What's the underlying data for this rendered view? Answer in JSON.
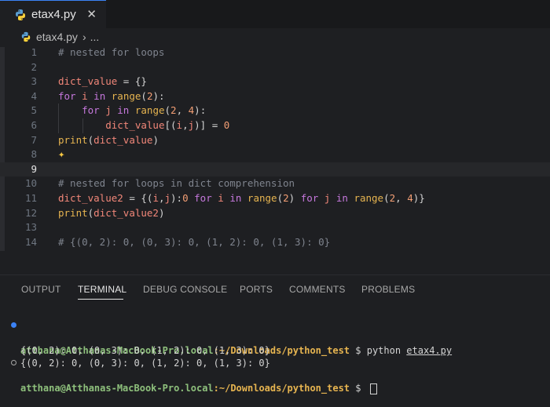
{
  "tab": {
    "label": "etax4.py",
    "close": "✕"
  },
  "breadcrumb": {
    "file": "etax4.py",
    "separator": "›",
    "more": "..."
  },
  "editor": {
    "active_line": 9,
    "lines": [
      {
        "n": "1",
        "tokens": [
          [
            "cm",
            "# nested for loops"
          ]
        ]
      },
      {
        "n": "2",
        "tokens": []
      },
      {
        "n": "3",
        "tokens": [
          [
            "var",
            "dict_value"
          ],
          [
            "op",
            " = "
          ],
          [
            "pn",
            "{}"
          ]
        ]
      },
      {
        "n": "4",
        "tokens": [
          [
            "kw",
            "for"
          ],
          [
            "op",
            " "
          ],
          [
            "var",
            "i"
          ],
          [
            "op",
            " "
          ],
          [
            "kw",
            "in"
          ],
          [
            "op",
            " "
          ],
          [
            "fn",
            "range"
          ],
          [
            "pn",
            "("
          ],
          [
            "num",
            "2"
          ],
          [
            "pn",
            "):"
          ]
        ]
      },
      {
        "n": "5",
        "tokens": [
          [
            "op",
            "    "
          ],
          [
            "kw",
            "for"
          ],
          [
            "op",
            " "
          ],
          [
            "var",
            "j"
          ],
          [
            "op",
            " "
          ],
          [
            "kw",
            "in"
          ],
          [
            "op",
            " "
          ],
          [
            "fn",
            "range"
          ],
          [
            "pn",
            "("
          ],
          [
            "num",
            "2"
          ],
          [
            "pn",
            ", "
          ],
          [
            "num",
            "4"
          ],
          [
            "pn",
            "):"
          ]
        ]
      },
      {
        "n": "6",
        "tokens": [
          [
            "op",
            "        "
          ],
          [
            "var",
            "dict_value"
          ],
          [
            "pn",
            "[("
          ],
          [
            "var",
            "i"
          ],
          [
            "pn",
            ","
          ],
          [
            "var",
            "j"
          ],
          [
            "pn",
            ")]"
          ],
          [
            "op",
            " = "
          ],
          [
            "num",
            "0"
          ]
        ]
      },
      {
        "n": "7",
        "tokens": [
          [
            "fn",
            "print"
          ],
          [
            "pn",
            "("
          ],
          [
            "var",
            "dict_value"
          ],
          [
            "pn",
            ")"
          ]
        ]
      },
      {
        "n": "8",
        "tokens": []
      },
      {
        "n": "9",
        "tokens": []
      },
      {
        "n": "10",
        "tokens": [
          [
            "cm",
            "# nested for loops in dict comprehension"
          ]
        ]
      },
      {
        "n": "11",
        "tokens": [
          [
            "var",
            "dict_value2"
          ],
          [
            "op",
            " = "
          ],
          [
            "pn",
            "{("
          ],
          [
            "var",
            "i"
          ],
          [
            "pn",
            ","
          ],
          [
            "var",
            "j"
          ],
          [
            "pn",
            "):"
          ],
          [
            "num",
            "0"
          ],
          [
            "op",
            " "
          ],
          [
            "kw",
            "for"
          ],
          [
            "op",
            " "
          ],
          [
            "var",
            "i"
          ],
          [
            "op",
            " "
          ],
          [
            "kw",
            "in"
          ],
          [
            "op",
            " "
          ],
          [
            "fn",
            "range"
          ],
          [
            "pn",
            "("
          ],
          [
            "num",
            "2"
          ],
          [
            "pn",
            ")"
          ],
          [
            "op",
            " "
          ],
          [
            "kw",
            "for"
          ],
          [
            "op",
            " "
          ],
          [
            "var",
            "j"
          ],
          [
            "op",
            " "
          ],
          [
            "kw",
            "in"
          ],
          [
            "op",
            " "
          ],
          [
            "fn",
            "range"
          ],
          [
            "pn",
            "("
          ],
          [
            "num",
            "2"
          ],
          [
            "pn",
            ", "
          ],
          [
            "num",
            "4"
          ],
          [
            "pn",
            ")}"
          ]
        ]
      },
      {
        "n": "12",
        "tokens": [
          [
            "fn",
            "print"
          ],
          [
            "pn",
            "("
          ],
          [
            "var",
            "dict_value2"
          ],
          [
            "pn",
            ")"
          ]
        ]
      },
      {
        "n": "13",
        "tokens": []
      },
      {
        "n": "14",
        "tokens": [
          [
            "cm",
            "# {(0, 2): 0, (0, 3): 0, (1, 2): 0, (1, 3): 0}"
          ]
        ]
      }
    ]
  },
  "panel": {
    "tabs": [
      "OUTPUT",
      "TERMINAL",
      "DEBUG CONSOLE",
      "PORTS",
      "COMMENTS",
      "PROBLEMS"
    ],
    "active_tab": "TERMINAL"
  },
  "terminal": {
    "user_host": "atthana@Atthanas-MacBook-Pro.local",
    "path": ":~/Downloads/python_test",
    "prompt": " $ ",
    "command": "python ",
    "file": "etax4.py",
    "output1": "{(0, 2): 0, (0, 3): 0, (1, 2): 0, (1, 3): 0}",
    "output2": "{(0, 2): 0, (0, 3): 0, (1, 2): 0, (1, 3): 0}"
  },
  "colors": {
    "accent": "#3b82f6",
    "background": "#1e1f22"
  }
}
